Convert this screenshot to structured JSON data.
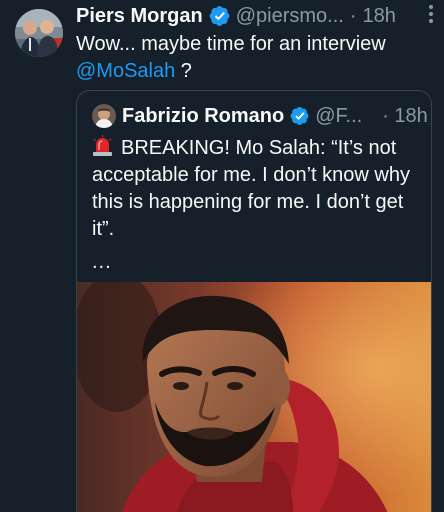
{
  "tweet": {
    "author_name": "Piers Morgan",
    "handle": "@piersmo...",
    "separator": "·",
    "time": "18h",
    "more_icon": "more-options-icon",
    "text_prefix": "Wow... maybe time for an interview",
    "mention": "@MoSalah",
    "text_suffix": " ?"
  },
  "quote": {
    "author_name": "Fabrizio Romano",
    "handle": "@F...",
    "time": "· 18h",
    "siren_icon": "siren-emoji-icon",
    "text": "BREAKING! Mo Salah: “It’s not acceptable for me. I don’t know why this is happening for me. I don’t get it”.",
    "ellipsis": "..."
  },
  "colors": {
    "background": "#15202b",
    "text": "#f7f9f9",
    "secondary": "#8b98a5",
    "link": "#1d9bf0",
    "verified": "#1d9bf0",
    "border": "#38444d"
  }
}
